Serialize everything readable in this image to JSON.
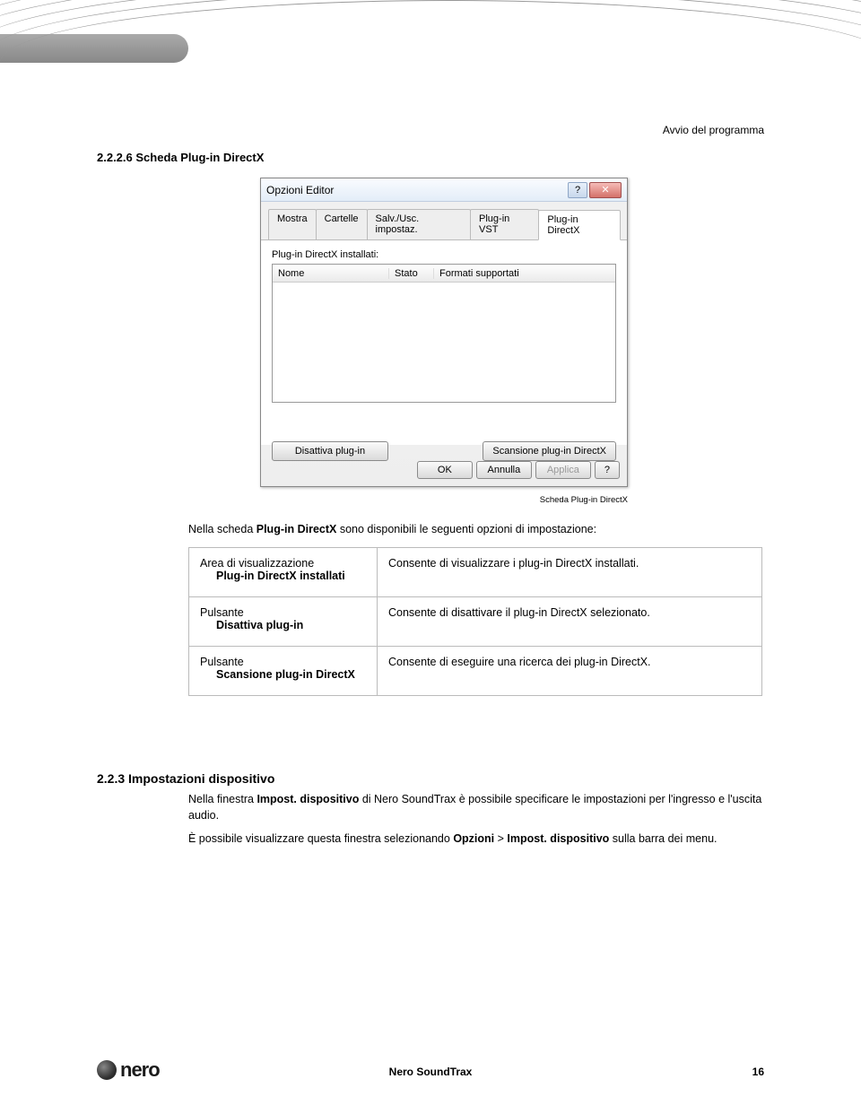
{
  "header_right": "Avvio del programma",
  "section_number": "2.2.2.6  Scheda Plug-in DirectX",
  "dialog": {
    "title": "Opzioni Editor",
    "help_icon": "?",
    "close_icon": "✕",
    "tabs": [
      "Mostra",
      "Cartelle",
      "Salv./Usc. impostaz.",
      "Plug-in VST",
      "Plug-in DirectX"
    ],
    "listbox_label": "Plug-in DirectX installati:",
    "cols": {
      "c1": "Nome",
      "c2": "Stato",
      "c3": "Formati supportati"
    },
    "btn_disable": "Disattiva plug-in",
    "btn_scan": "Scansione plug-in DirectX",
    "btn_ok": "OK",
    "btn_cancel": "Annulla",
    "btn_apply": "Applica",
    "btn_q": "?"
  },
  "caption": "Scheda Plug-in DirectX",
  "intro_pre": "Nella scheda ",
  "intro_bold": "Plug-in DirectX",
  "intro_post": " sono disponibili le seguenti opzioni di impostazione:",
  "table": {
    "r1": {
      "l1": "Area di visualizzazione",
      "l2": "Plug-in DirectX installati",
      "r": "Consente di visualizzare i plug-in DirectX installati."
    },
    "r2": {
      "l1": "Pulsante",
      "l2": "Disattiva plug-in",
      "r": "Consente di disattivare il plug-in DirectX selezionato."
    },
    "r3": {
      "l1": "Pulsante",
      "l2": "Scansione plug-in DirectX",
      "r": "Consente di eseguire una ricerca dei plug-in DirectX."
    }
  },
  "section2": {
    "heading": "2.2.3   Impostazioni dispositivo",
    "p1_pre": "Nella finestra ",
    "p1_b1": "Impost. dispositivo",
    "p1_post": " di Nero SoundTrax è possibile specificare le impostazioni per l'ingresso e l'uscita audio.",
    "p2_pre": "È possibile visualizzare questa finestra selezionando ",
    "p2_b1": "Opzioni",
    "p2_mid": " > ",
    "p2_b2": "Impost. dispositivo",
    "p2_post": " sulla barra dei menu."
  },
  "footer": {
    "logo": "nero",
    "center": "Nero SoundTrax",
    "page": "16"
  }
}
